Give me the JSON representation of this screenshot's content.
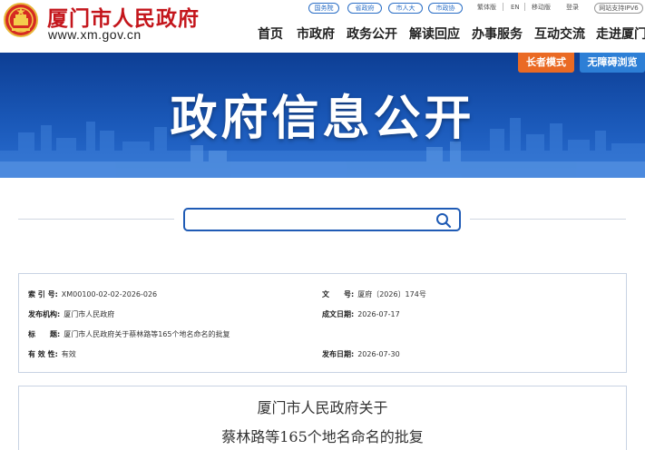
{
  "header": {
    "site_name": "厦门市人民政府",
    "site_url": "www.xm.gov.cn",
    "quick_links": [
      "国务院",
      "省政府",
      "市人大",
      "市政协"
    ],
    "top_links": [
      "繁体版",
      "EN",
      "移动版",
      "登录"
    ],
    "ipv6_label": "网站支持IPV6",
    "nav": [
      "首页",
      "市政府",
      "政务公开",
      "解读回应",
      "办事服务",
      "互动交流",
      "走进厦门"
    ]
  },
  "banner": {
    "title": "政府信息公开",
    "elder_mode": "长者模式",
    "barrier_free": "无障碍浏览"
  },
  "search": {
    "placeholder": ""
  },
  "doc_info": {
    "index_label": "索 引 号:",
    "index_value": "XM00100-02-02-2026-026",
    "doc_no_label": "文　　号:",
    "doc_no_value": "厦府〔2026〕174号",
    "issuer_label": "发布机构:",
    "issuer_value": "厦门市人民政府",
    "written_label": "成文日期:",
    "written_value": "2026-07-17",
    "title_label": "标　　题:",
    "title_value": "厦门市人民政府关于蔡林路等165个地名命名的批复",
    "validity_label": "有 效 性:",
    "validity_value": "有效",
    "publish_label": "发布日期:",
    "publish_value": "2026-07-30"
  },
  "document": {
    "title_line1": "厦门市人民政府关于",
    "title_line2": "蔡林路等165个地名命名的批复"
  },
  "colors": {
    "brand_red": "#c4161c",
    "banner_blue": "#1a58b8",
    "elder_orange": "#ea6a24",
    "link_blue": "#2a6ec6"
  }
}
